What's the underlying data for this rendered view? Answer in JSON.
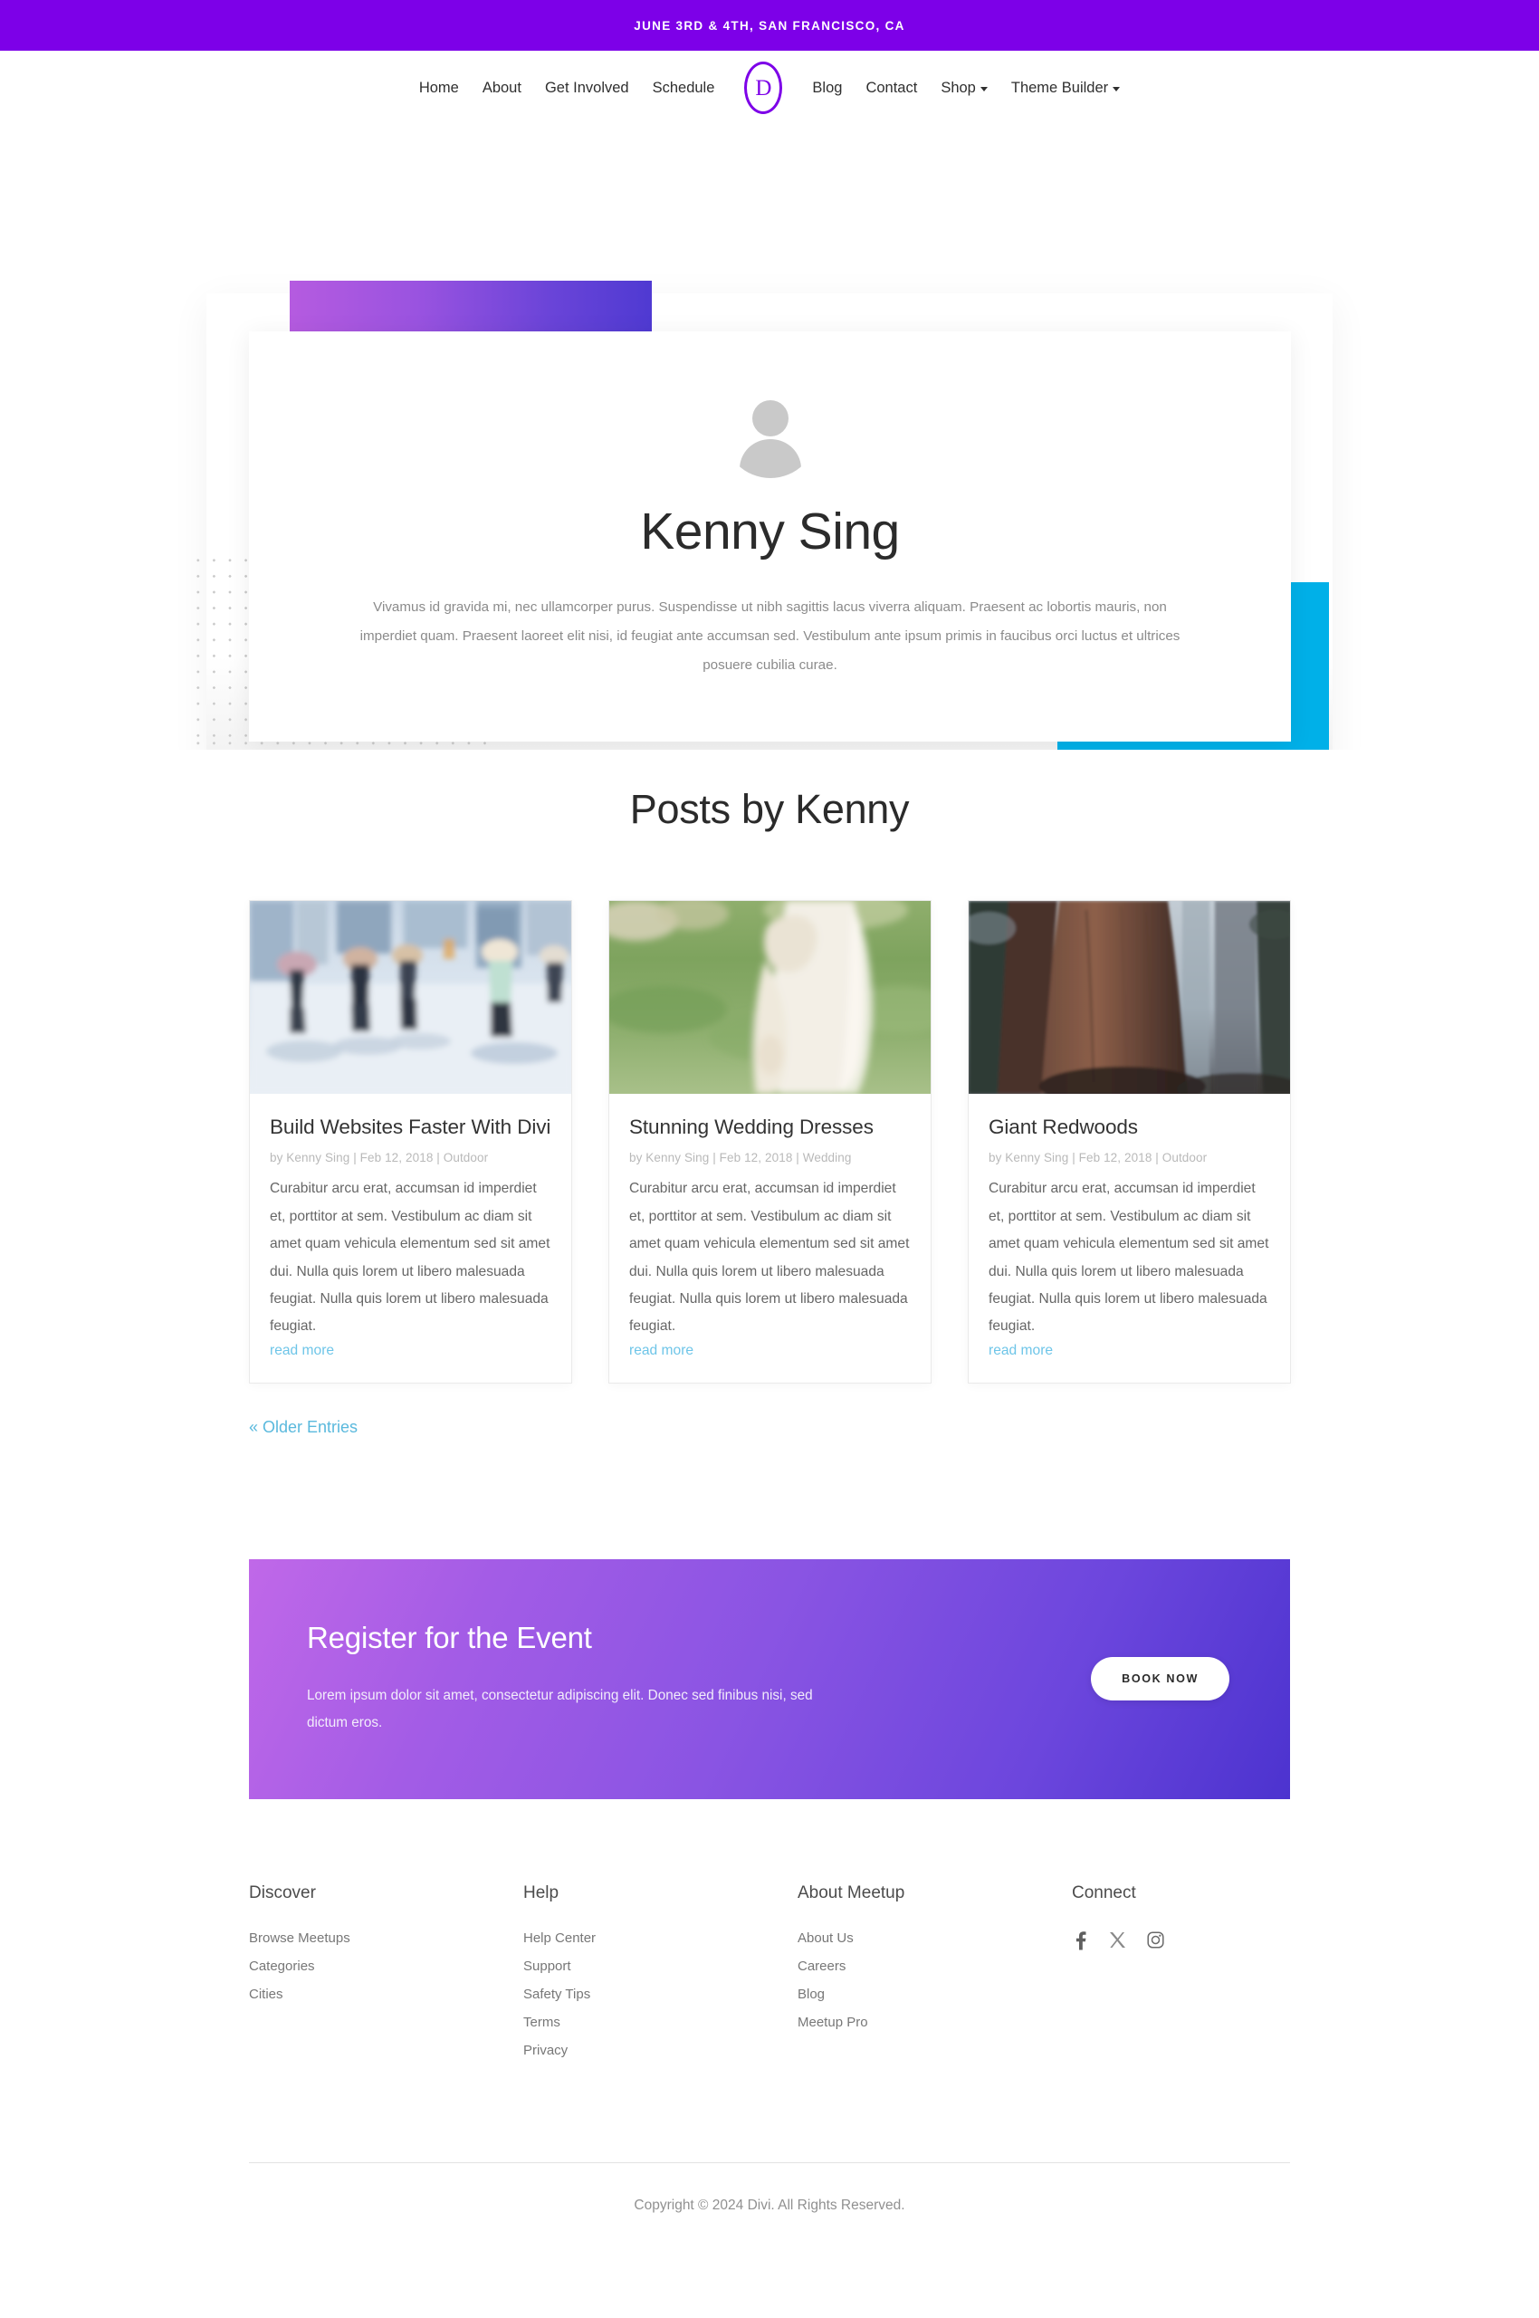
{
  "announcement": {
    "text": "JUNE 3RD & 4TH, SAN FRANCISCO, CA",
    "bg_color": "#7d00e8"
  },
  "nav": {
    "logo_letter": "D",
    "logo_color": "#7d00e8",
    "left_items": [
      {
        "label": "Home",
        "has_caret": false
      },
      {
        "label": "About",
        "has_caret": false
      },
      {
        "label": "Get Involved",
        "has_caret": false
      },
      {
        "label": "Schedule",
        "has_caret": false
      }
    ],
    "right_items": [
      {
        "label": "Blog",
        "has_caret": false
      },
      {
        "label": "Contact",
        "has_caret": false
      },
      {
        "label": "Shop",
        "has_caret": true
      },
      {
        "label": "Theme Builder",
        "has_caret": true
      }
    ]
  },
  "hero": {
    "avatar_alt": "user-avatar-placeholder",
    "name": "Kenny Sing",
    "bio": "Vivamus id gravida mi, nec ullamcorper purus. Suspendisse ut nibh sagittis lacus viverra aliquam. Praesent ac lobortis mauris, non imperdiet quam. Praesent laoreet elit nisi, id feugiat ante accumsan sed. Vestibulum ante ipsum primis in faucibus orci luctus et ultrices posuere cubilia curae.",
    "accent_gradient_from": "#b55be0",
    "accent_gradient_to": "#4f3ad2",
    "accent_blue": "#00b0e8"
  },
  "posts": {
    "heading": "Posts by Kenny",
    "older_entries_label": "« Older Entries",
    "items": [
      {
        "title": "Build Websites Faster With Divi",
        "meta": "by Kenny Sing | Feb 12, 2018 | Outdoor",
        "excerpt": "Curabitur arcu erat, accumsan id imperdiet et, porttitor at sem. Vestibulum ac diam sit amet quam vehicula elementum sed sit amet dui. Nulla quis lorem ut libero malesuada feugiat. Nulla quis lorem ut libero malesuada feugiat.",
        "read_more_label": "read more",
        "image_name": "city-crosswalk-pedestrians-photo"
      },
      {
        "title": "Stunning Wedding Dresses",
        "meta": "by Kenny Sing | Feb 12, 2018 | Wedding",
        "excerpt": "Curabitur arcu erat, accumsan id imperdiet et, porttitor at sem. Vestibulum ac diam sit amet quam vehicula elementum sed sit amet dui. Nulla quis lorem ut libero malesuada feugiat. Nulla quis lorem ut libero malesuada feugiat.",
        "read_more_label": "read more",
        "image_name": "bride-white-dress-lawn-photo"
      },
      {
        "title": "Giant Redwoods",
        "meta": "by Kenny Sing | Feb 12, 2018 | Outdoor",
        "excerpt": "Curabitur arcu erat, accumsan id imperdiet et, porttitor at sem. Vestibulum ac diam sit amet quam vehicula elementum sed sit amet dui. Nulla quis lorem ut libero malesuada feugiat. Nulla quis lorem ut libero malesuada feugiat.",
        "read_more_label": "read more",
        "image_name": "misty-redwood-forest-photo"
      }
    ]
  },
  "cta": {
    "title": "Register for the Event",
    "subtitle": "Lorem ipsum dolor sit amet, consectetur adipiscing elit. Donec sed finibus nisi, sed dictum eros.",
    "button_label": "BOOK NOW",
    "gradient_from": "#c068e8",
    "gradient_to": "#4c33cf"
  },
  "footer": {
    "columns": [
      {
        "title": "Discover",
        "links": [
          "Browse Meetups",
          "Categories",
          "Cities"
        ]
      },
      {
        "title": "Help",
        "links": [
          "Help Center",
          "Support",
          "Safety Tips",
          "Terms",
          "Privacy"
        ]
      },
      {
        "title": "About Meetup",
        "links": [
          "About Us",
          "Careers",
          "Blog",
          "Meetup Pro"
        ]
      }
    ],
    "connect": {
      "title": "Connect",
      "socials": [
        "facebook-icon",
        "x-twitter-icon",
        "instagram-icon"
      ]
    },
    "copyright": "Copyright © 2024 Divi. All Rights Reserved."
  }
}
